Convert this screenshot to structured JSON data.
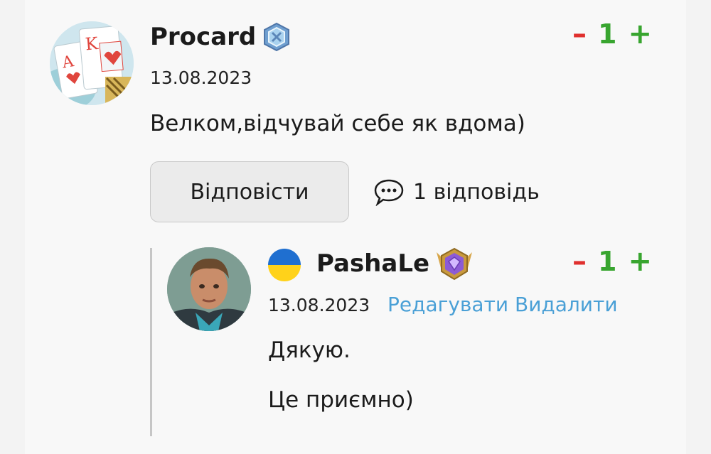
{
  "comment": {
    "author": "Procard",
    "badge_icon": "hexagon-rank-badge-icon",
    "date": "13.08.2023",
    "text": "Велком,відчувай себе як вдома)",
    "votes": {
      "minus": "–",
      "count": "1",
      "plus": "+"
    },
    "reply_label": "Відповісти",
    "replies_label": "1 відповідь"
  },
  "reply": {
    "author": "PashaLe",
    "flag_icon": "ukraine-flag-icon",
    "badge_icon": "purple-diamond-rank-badge-icon",
    "date": "13.08.2023",
    "edit_label": "Редагувати",
    "delete_label": "Видалити",
    "text_line1": "Дякую.",
    "text_line2": "Це приємно)",
    "votes": {
      "minus": "–",
      "count": "1",
      "plus": "+"
    }
  },
  "colors": {
    "minus": "#e0302e",
    "plus": "#38a52f",
    "link": "#4aa0d6",
    "card": "#f8f8f8"
  }
}
